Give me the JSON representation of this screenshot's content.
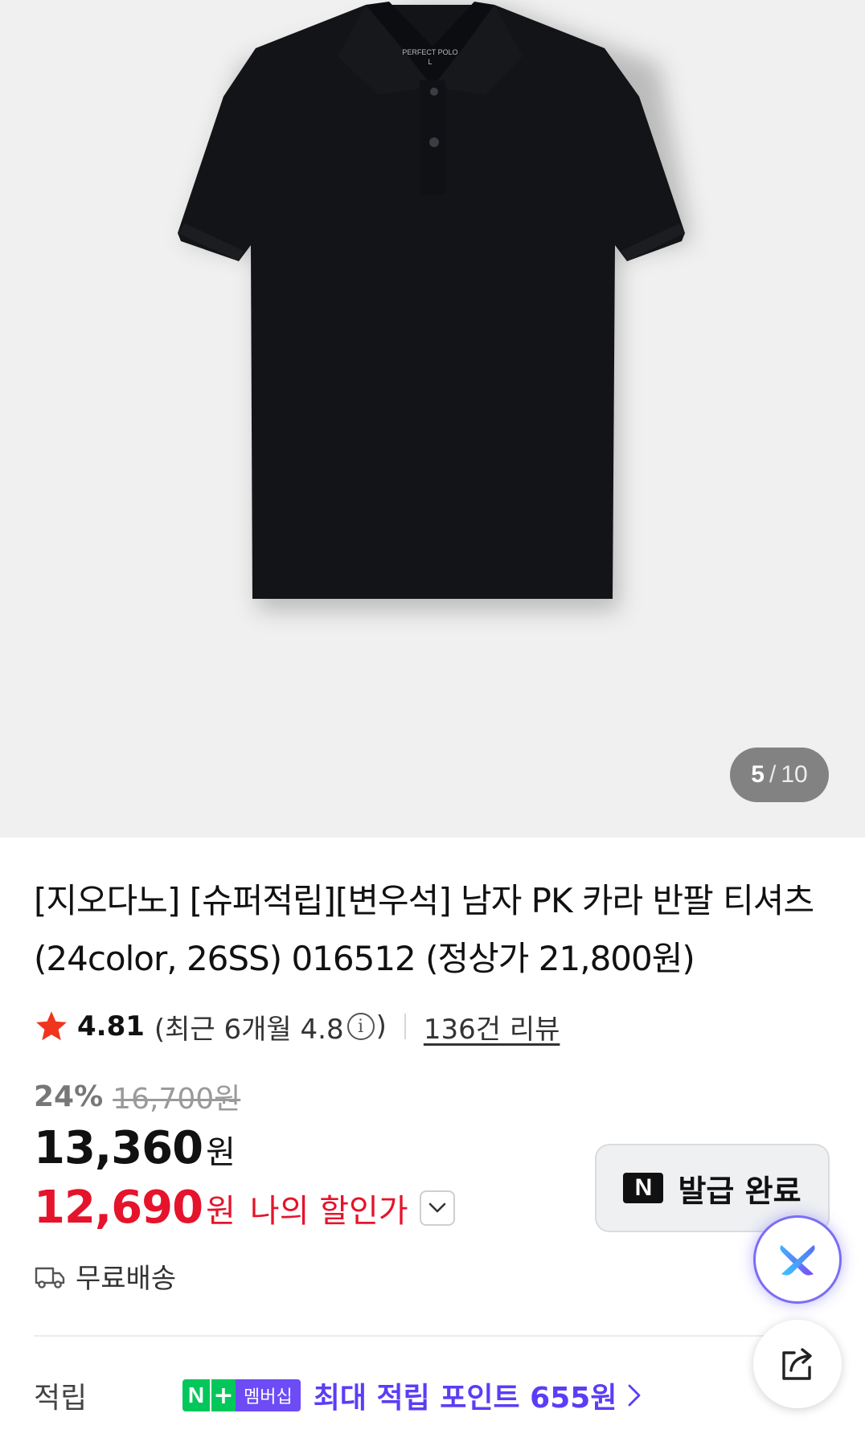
{
  "gallery": {
    "current": "5",
    "separator": "/",
    "total": "10",
    "tag_text": "PERFECT POLO",
    "tag_size": "L"
  },
  "product": {
    "title": "[지오다노] [슈퍼적립][변우석] 남자 PK 카라 반팔 티셔츠 (24color, 26SS) 016512 (정상가 21,800원)"
  },
  "rating": {
    "score": "4.81",
    "recent_prefix": "(최근 6개월 4.8",
    "recent_suffix": ")",
    "reviews": "136건 리뷰",
    "star_color": "#f0351e"
  },
  "price": {
    "discount_percent": "24%",
    "original": "16,700원",
    "sale_amount": "13,360",
    "sale_unit": "원",
    "my_amount": "12,690",
    "my_unit": "원",
    "my_label": "나의 할인가",
    "accent_color": "#e5132b"
  },
  "coupon": {
    "logo": "N",
    "label": "발급 완료"
  },
  "shipping": {
    "label": "무료배송",
    "icon": "truck-icon"
  },
  "points": {
    "label": "적립",
    "badge_n": "N",
    "badge_plus": "+",
    "badge_member": "멤버십",
    "text": "최대 적립 포인트 655원",
    "accent_color": "#5b3df5"
  },
  "floating": {
    "ai_icon": "ai-assistant-icon",
    "share_icon": "share-icon"
  }
}
